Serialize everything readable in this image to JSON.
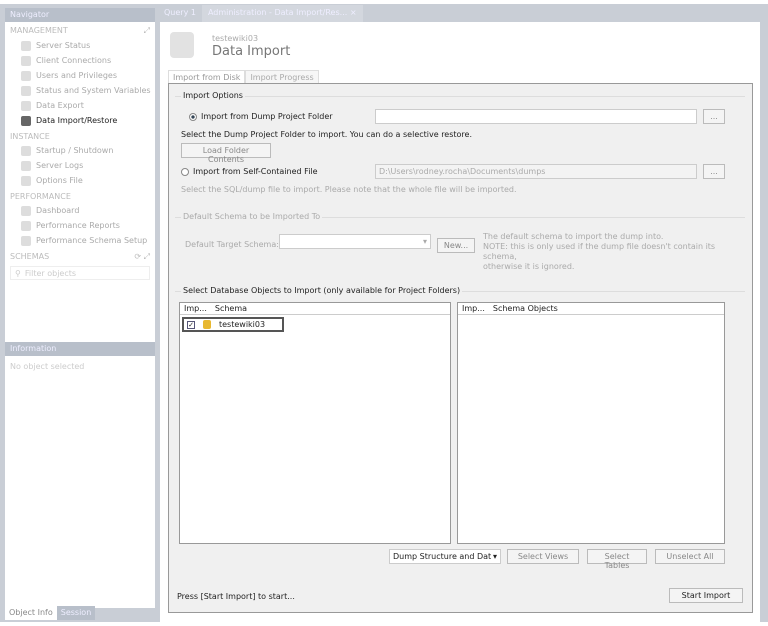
{
  "navigator": {
    "title": "Navigator",
    "management": {
      "label": "MANAGEMENT",
      "items": [
        {
          "label": "Server Status",
          "icon": "gauge-icon"
        },
        {
          "label": "Client Connections",
          "icon": "monitor-icon"
        },
        {
          "label": "Users and Privileges",
          "icon": "user-icon"
        },
        {
          "label": "Status and System Variables",
          "icon": "variables-icon"
        },
        {
          "label": "Data Export",
          "icon": "export-icon"
        },
        {
          "label": "Data Import/Restore",
          "icon": "import-icon",
          "active": true
        }
      ]
    },
    "instance": {
      "label": "INSTANCE",
      "items": [
        {
          "label": "Startup / Shutdown"
        },
        {
          "label": "Server Logs"
        },
        {
          "label": "Options File"
        }
      ]
    },
    "performance": {
      "label": "PERFORMANCE",
      "items": [
        {
          "label": "Dashboard"
        },
        {
          "label": "Performance Reports"
        },
        {
          "label": "Performance Schema Setup"
        }
      ]
    },
    "schemas": {
      "label": "SCHEMAS",
      "filter_placeholder": "Filter objects"
    }
  },
  "information": {
    "title": "Information",
    "text": "No object selected"
  },
  "bottom_tabs": [
    "Object Info",
    "Session"
  ],
  "tabs": [
    {
      "label": "Query 1"
    },
    {
      "label": "Administration - Data Import/Res...",
      "close": "×"
    }
  ],
  "header": {
    "subtitle": "testewiki03",
    "title": "Data Import"
  },
  "subtabs": [
    "Import from Disk",
    "Import Progress"
  ],
  "import_options": {
    "label": "Import Options",
    "opt1": "Import from Dump Project Folder",
    "opt1_value": "",
    "browse": "...",
    "hint1": "Select the Dump Project Folder to import. You can do a selective restore.",
    "load_btn": "Load Folder Contents",
    "opt2": "Import from Self-Contained File",
    "opt2_value": "D:\\Users\\rodney.rocha\\Documents\\dumps",
    "hint2": "Select the SQL/dump file to import. Please note that the whole file will be imported."
  },
  "default_schema": {
    "label": "Default Schema to be Imported To",
    "field_label": "Default Target Schema:",
    "new_btn": "New...",
    "note1": "The default schema to import the dump into.",
    "note2": "NOTE: this is only used if the dump file doesn't contain its schema,",
    "note3": "otherwise it is ignored."
  },
  "objects": {
    "label": "Select Database Objects to Import (only available for Project Folders)",
    "left_cols": [
      "Imp...",
      "Schema"
    ],
    "right_cols": [
      "Imp...",
      "Schema Objects"
    ],
    "rows": [
      {
        "checked": true,
        "schema": "testewiki03"
      }
    ],
    "dump_select": "Dump Structure and Dat",
    "select_views": "Select Views",
    "select_tables": "Select Tables",
    "unselect_all": "Unselect All"
  },
  "status": "Press [Start Import] to start...",
  "start_btn": "Start Import"
}
